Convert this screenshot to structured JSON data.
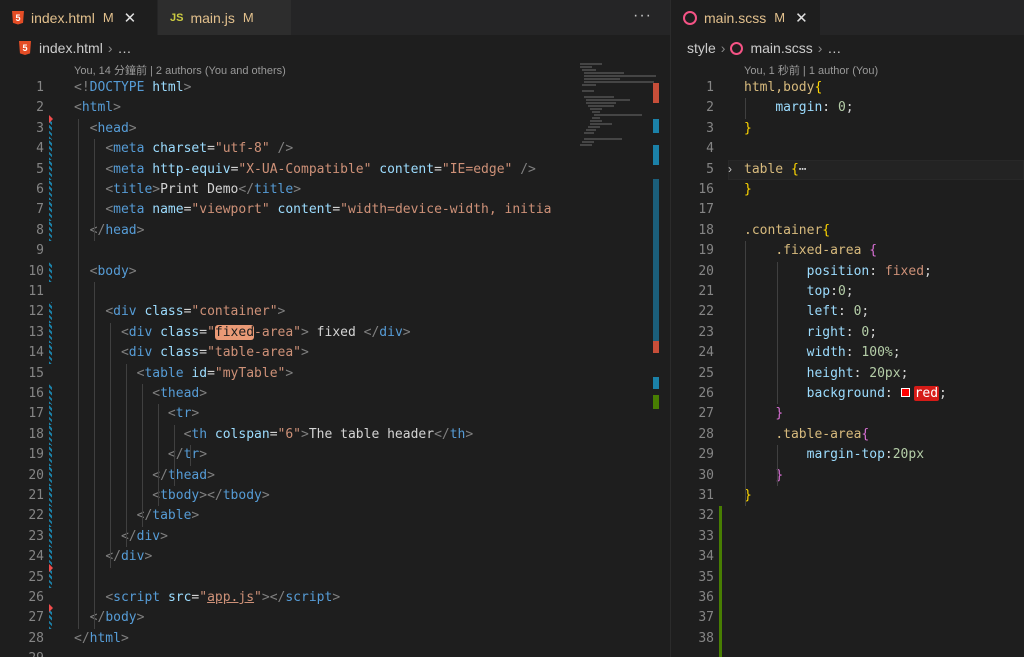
{
  "left_editor": {
    "tabs": [
      {
        "label": "index.html",
        "status": "M",
        "icon": "html5-icon"
      },
      {
        "label": "main.js",
        "status": "M",
        "icon": "js-icon",
        "icon_text": "JS"
      }
    ],
    "more_actions": "···",
    "breadcrumb": {
      "file": "index.html",
      "rest": "…"
    },
    "codelens": "You, 14 分鐘前 | 2 authors (You and others)",
    "lines": [
      {
        "n": "1",
        "parts": [
          [
            "p",
            "<!"
          ],
          [
            "t",
            "DOCTYPE"
          ],
          [
            "x",
            " "
          ],
          [
            "a",
            "html"
          ],
          [
            "p",
            ">"
          ]
        ]
      },
      {
        "n": "2",
        "parts": [
          [
            "p",
            "<"
          ],
          [
            "t",
            "html"
          ],
          [
            "p",
            ">"
          ]
        ]
      },
      {
        "n": "3",
        "parts": [
          [
            "x",
            "  "
          ],
          [
            "p",
            "<"
          ],
          [
            "t",
            "head"
          ],
          [
            "p",
            ">"
          ]
        ]
      },
      {
        "n": "4",
        "parts": [
          [
            "x",
            "    "
          ],
          [
            "p",
            "<"
          ],
          [
            "t",
            "meta"
          ],
          [
            "x",
            " "
          ],
          [
            "a",
            "charset"
          ],
          [
            "x",
            "="
          ],
          [
            "s",
            "\"utf-8\""
          ],
          [
            "x",
            " "
          ],
          [
            "p",
            "/>"
          ]
        ]
      },
      {
        "n": "5",
        "parts": [
          [
            "x",
            "    "
          ],
          [
            "p",
            "<"
          ],
          [
            "t",
            "meta"
          ],
          [
            "x",
            " "
          ],
          [
            "a",
            "http-equiv"
          ],
          [
            "x",
            "="
          ],
          [
            "s",
            "\"X-UA-Compatible\""
          ],
          [
            "x",
            " "
          ],
          [
            "a",
            "content"
          ],
          [
            "x",
            "="
          ],
          [
            "s",
            "\"IE=edge\""
          ],
          [
            "x",
            " "
          ],
          [
            "p",
            "/>"
          ]
        ]
      },
      {
        "n": "6",
        "parts": [
          [
            "x",
            "    "
          ],
          [
            "p",
            "<"
          ],
          [
            "t",
            "title"
          ],
          [
            "p",
            ">"
          ],
          [
            "x",
            "Print Demo"
          ],
          [
            "p",
            "</"
          ],
          [
            "t",
            "title"
          ],
          [
            "p",
            ">"
          ]
        ]
      },
      {
        "n": "7",
        "parts": [
          [
            "x",
            "    "
          ],
          [
            "p",
            "<"
          ],
          [
            "t",
            "meta"
          ],
          [
            "x",
            " "
          ],
          [
            "a",
            "name"
          ],
          [
            "x",
            "="
          ],
          [
            "s",
            "\"viewport\""
          ],
          [
            "x",
            " "
          ],
          [
            "a",
            "content"
          ],
          [
            "x",
            "="
          ],
          [
            "s",
            "\"width=device-width, initia"
          ]
        ]
      },
      {
        "n": "8",
        "parts": [
          [
            "x",
            "  "
          ],
          [
            "p",
            "</"
          ],
          [
            "t",
            "head"
          ],
          [
            "p",
            ">"
          ]
        ]
      },
      {
        "n": "9",
        "parts": []
      },
      {
        "n": "10",
        "parts": [
          [
            "x",
            "  "
          ],
          [
            "p",
            "<"
          ],
          [
            "t",
            "body"
          ],
          [
            "p",
            ">"
          ]
        ]
      },
      {
        "n": "11",
        "parts": []
      },
      {
        "n": "12",
        "parts": [
          [
            "x",
            "    "
          ],
          [
            "p",
            "<"
          ],
          [
            "t",
            "div"
          ],
          [
            "x",
            " "
          ],
          [
            "a",
            "class"
          ],
          [
            "x",
            "="
          ],
          [
            "s",
            "\"container\""
          ],
          [
            "p",
            ">"
          ]
        ]
      },
      {
        "n": "13",
        "parts": [
          [
            "x",
            "      "
          ],
          [
            "p",
            "<"
          ],
          [
            "t",
            "div"
          ],
          [
            "x",
            " "
          ],
          [
            "a",
            "class"
          ],
          [
            "x",
            "="
          ],
          [
            "s",
            "\""
          ],
          [
            "hl",
            "fixed"
          ],
          [
            "s",
            "-area\""
          ],
          [
            "p",
            ">"
          ],
          [
            "x",
            " fixed "
          ],
          [
            "p",
            "</"
          ],
          [
            "t",
            "div"
          ],
          [
            "p",
            ">"
          ]
        ]
      },
      {
        "n": "14",
        "parts": [
          [
            "x",
            "      "
          ],
          [
            "p",
            "<"
          ],
          [
            "t",
            "div"
          ],
          [
            "x",
            " "
          ],
          [
            "a",
            "class"
          ],
          [
            "x",
            "="
          ],
          [
            "s",
            "\"table-area\""
          ],
          [
            "p",
            ">"
          ]
        ]
      },
      {
        "n": "15",
        "parts": [
          [
            "x",
            "        "
          ],
          [
            "p",
            "<"
          ],
          [
            "t",
            "table"
          ],
          [
            "x",
            " "
          ],
          [
            "a",
            "id"
          ],
          [
            "x",
            "="
          ],
          [
            "s",
            "\"myTable\""
          ],
          [
            "p",
            ">"
          ]
        ]
      },
      {
        "n": "16",
        "parts": [
          [
            "x",
            "          "
          ],
          [
            "p",
            "<"
          ],
          [
            "t",
            "thead"
          ],
          [
            "p",
            ">"
          ]
        ]
      },
      {
        "n": "17",
        "parts": [
          [
            "x",
            "            "
          ],
          [
            "p",
            "<"
          ],
          [
            "t",
            "tr"
          ],
          [
            "p",
            ">"
          ]
        ]
      },
      {
        "n": "18",
        "parts": [
          [
            "x",
            "              "
          ],
          [
            "p",
            "<"
          ],
          [
            "t",
            "th"
          ],
          [
            "x",
            " "
          ],
          [
            "a",
            "colspan"
          ],
          [
            "x",
            "="
          ],
          [
            "s",
            "\"6\""
          ],
          [
            "p",
            ">"
          ],
          [
            "x",
            "The table header"
          ],
          [
            "p",
            "</"
          ],
          [
            "t",
            "th"
          ],
          [
            "p",
            ">"
          ]
        ]
      },
      {
        "n": "19",
        "parts": [
          [
            "x",
            "            "
          ],
          [
            "p",
            "</"
          ],
          [
            "t",
            "tr"
          ],
          [
            "p",
            ">"
          ]
        ]
      },
      {
        "n": "20",
        "parts": [
          [
            "x",
            "          "
          ],
          [
            "p",
            "</"
          ],
          [
            "t",
            "thead"
          ],
          [
            "p",
            ">"
          ]
        ]
      },
      {
        "n": "21",
        "parts": [
          [
            "x",
            "          "
          ],
          [
            "p",
            "<"
          ],
          [
            "t",
            "tbody"
          ],
          [
            "p",
            "></"
          ],
          [
            "t",
            "tbody"
          ],
          [
            "p",
            ">"
          ]
        ]
      },
      {
        "n": "22",
        "parts": [
          [
            "x",
            "        "
          ],
          [
            "p",
            "</"
          ],
          [
            "t",
            "table"
          ],
          [
            "p",
            ">"
          ]
        ]
      },
      {
        "n": "23",
        "parts": [
          [
            "x",
            "      "
          ],
          [
            "p",
            "</"
          ],
          [
            "t",
            "div"
          ],
          [
            "p",
            ">"
          ]
        ]
      },
      {
        "n": "24",
        "parts": [
          [
            "x",
            "    "
          ],
          [
            "p",
            "</"
          ],
          [
            "t",
            "div"
          ],
          [
            "p",
            ">"
          ]
        ]
      },
      {
        "n": "25",
        "parts": []
      },
      {
        "n": "26",
        "parts": [
          [
            "x",
            "    "
          ],
          [
            "p",
            "<"
          ],
          [
            "t",
            "script"
          ],
          [
            "x",
            " "
          ],
          [
            "a",
            "src"
          ],
          [
            "x",
            "="
          ],
          [
            "s",
            "\""
          ],
          [
            "su",
            "app.js"
          ],
          [
            "s",
            "\""
          ],
          [
            "p",
            "></"
          ],
          [
            "t",
            "script"
          ],
          [
            "p",
            ">"
          ]
        ]
      },
      {
        "n": "27",
        "parts": [
          [
            "x",
            "  "
          ],
          [
            "p",
            "</"
          ],
          [
            "t",
            "body"
          ],
          [
            "p",
            ">"
          ]
        ]
      },
      {
        "n": "28",
        "parts": [
          [
            "p",
            "</"
          ],
          [
            "t",
            "html"
          ],
          [
            "p",
            ">"
          ]
        ]
      }
    ]
  },
  "right_editor": {
    "tab": {
      "label": "main.scss",
      "status": "M",
      "icon": "sass-icon",
      "close": "✕"
    },
    "breadcrumb": {
      "folder": "style",
      "file": "main.scss",
      "rest": "…"
    },
    "codelens": "You, 1 秒前 | 1 author (You)",
    "lines": [
      {
        "n": "1",
        "parts": [
          [
            "sel",
            "html,body"
          ],
          [
            "br1",
            "{"
          ]
        ]
      },
      {
        "n": "2",
        "parts": [
          [
            "x",
            "    "
          ],
          [
            "prop",
            "margin"
          ],
          [
            "x",
            ": "
          ],
          [
            "num",
            "0"
          ],
          [
            "x",
            ";"
          ]
        ]
      },
      {
        "n": "3",
        "parts": [
          [
            "br1",
            "}"
          ]
        ]
      },
      {
        "n": "4",
        "parts": []
      },
      {
        "n": "5",
        "parts": [
          [
            "sel",
            "table"
          ],
          [
            "x",
            " "
          ],
          [
            "br1",
            "{"
          ],
          [
            "x",
            "⋯"
          ]
        ]
      },
      {
        "n": "16",
        "parts": [
          [
            "br1",
            "}"
          ]
        ]
      },
      {
        "n": "17",
        "parts": []
      },
      {
        "n": "18",
        "parts": [
          [
            "sel",
            ".container"
          ],
          [
            "br1",
            "{"
          ]
        ]
      },
      {
        "n": "19",
        "parts": [
          [
            "x",
            "    "
          ],
          [
            "sel",
            ".fixed-area"
          ],
          [
            "x",
            " "
          ],
          [
            "br2",
            "{"
          ]
        ]
      },
      {
        "n": "20",
        "parts": [
          [
            "x",
            "        "
          ],
          [
            "prop",
            "position"
          ],
          [
            "x",
            ": "
          ],
          [
            "val",
            "fixed"
          ],
          [
            "x",
            ";"
          ]
        ]
      },
      {
        "n": "21",
        "parts": [
          [
            "x",
            "        "
          ],
          [
            "prop",
            "top"
          ],
          [
            "x",
            ":"
          ],
          [
            "num",
            "0"
          ],
          [
            "x",
            ";"
          ]
        ]
      },
      {
        "n": "22",
        "parts": [
          [
            "x",
            "        "
          ],
          [
            "prop",
            "left"
          ],
          [
            "x",
            ": "
          ],
          [
            "num",
            "0"
          ],
          [
            "x",
            ";"
          ]
        ]
      },
      {
        "n": "23",
        "parts": [
          [
            "x",
            "        "
          ],
          [
            "prop",
            "right"
          ],
          [
            "x",
            ": "
          ],
          [
            "num",
            "0"
          ],
          [
            "x",
            ";"
          ]
        ]
      },
      {
        "n": "24",
        "parts": [
          [
            "x",
            "        "
          ],
          [
            "prop",
            "width"
          ],
          [
            "x",
            ": "
          ],
          [
            "num",
            "100%"
          ],
          [
            "x",
            ";"
          ]
        ]
      },
      {
        "n": "25",
        "parts": [
          [
            "x",
            "        "
          ],
          [
            "prop",
            "height"
          ],
          [
            "x",
            ": "
          ],
          [
            "num",
            "20px"
          ],
          [
            "x",
            ";"
          ]
        ]
      },
      {
        "n": "26",
        "parts": [
          [
            "x",
            "        "
          ],
          [
            "prop",
            "background"
          ],
          [
            "x",
            ": "
          ],
          [
            "sw",
            ""
          ],
          [
            "red",
            "red"
          ],
          [
            "x",
            ";"
          ]
        ]
      },
      {
        "n": "27",
        "parts": [
          [
            "x",
            "    "
          ],
          [
            "br2",
            "}"
          ]
        ]
      },
      {
        "n": "28",
        "parts": [
          [
            "x",
            "    "
          ],
          [
            "sel",
            ".table-area"
          ],
          [
            "br2",
            "{"
          ]
        ]
      },
      {
        "n": "29",
        "parts": [
          [
            "x",
            "        "
          ],
          [
            "prop",
            "margin-top"
          ],
          [
            "x",
            ":"
          ],
          [
            "num",
            "20px"
          ]
        ]
      },
      {
        "n": "30",
        "parts": [
          [
            "x",
            "    "
          ],
          [
            "br2",
            "}"
          ]
        ]
      },
      {
        "n": "31",
        "parts": [
          [
            "br1",
            "}"
          ]
        ]
      },
      {
        "n": "32",
        "parts": []
      },
      {
        "n": "33",
        "parts": []
      },
      {
        "n": "34",
        "parts": []
      },
      {
        "n": "35",
        "parts": []
      },
      {
        "n": "36",
        "parts": []
      },
      {
        "n": "37",
        "parts": []
      },
      {
        "n": "38",
        "parts": []
      }
    ]
  }
}
